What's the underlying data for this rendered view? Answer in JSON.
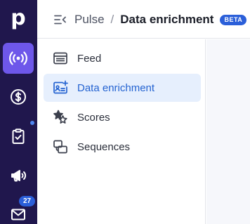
{
  "app": {
    "name": "Pipedrive",
    "logo_letter": "p"
  },
  "rail": {
    "items": [
      {
        "name": "pulse",
        "icon": "broadcast-icon",
        "active": true
      },
      {
        "name": "deals",
        "icon": "dollar-icon",
        "active": false
      },
      {
        "name": "tasks",
        "icon": "clipboard-check-icon",
        "active": false,
        "has_dot": true
      },
      {
        "name": "campaigns",
        "icon": "megaphone-icon",
        "active": false
      },
      {
        "name": "mail",
        "icon": "mail-icon",
        "active": false,
        "badge": "27"
      }
    ],
    "colors": {
      "background": "#20174d",
      "active": "#6e57ea",
      "badge": "#2b5fd9"
    }
  },
  "header": {
    "breadcrumb_parent": "Pulse",
    "breadcrumb_separator": "/",
    "title": "Data enrichment",
    "badge": "BETA"
  },
  "menu": {
    "items": [
      {
        "label": "Feed",
        "icon": "feed-icon",
        "active": false
      },
      {
        "label": "Data enrichment",
        "icon": "enrichment-card-icon",
        "active": true
      },
      {
        "label": "Scores",
        "icon": "stars-icon",
        "active": false
      },
      {
        "label": "Sequences",
        "icon": "sequences-icon",
        "active": false
      }
    ],
    "active_color": "#2463d1",
    "active_background": "#e6effd"
  }
}
